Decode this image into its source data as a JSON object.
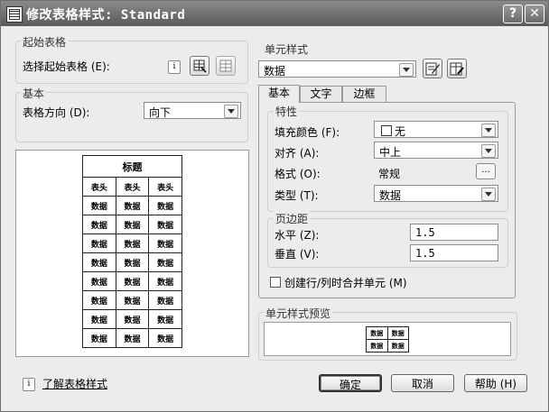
{
  "window": {
    "title": "修改表格样式: Standard",
    "help_glyph": "?",
    "close_glyph": "✕"
  },
  "starting_table": {
    "group_label": "起始表格",
    "select_label": "选择起始表格 (E):"
  },
  "general": {
    "group_label": "基本",
    "direction_label": "表格方向 (D):",
    "direction_value": "向下"
  },
  "preview_table": {
    "title": "标题",
    "headers": [
      "表头",
      "表头",
      "表头"
    ],
    "cell": "数据",
    "data_rows": 8
  },
  "cell_style": {
    "group_label": "单元样式",
    "value": "数据",
    "tabs": [
      "基本",
      "文字",
      "边框"
    ],
    "active_tab": "基本"
  },
  "properties": {
    "group_label": "特性",
    "fill_label": "填充颜色 (F):",
    "fill_value": "无",
    "align_label": "对齐 (A):",
    "align_value": "中上",
    "format_label": "格式 (O):",
    "format_value": "常规",
    "format_button": "...",
    "type_label": "类型 (T):",
    "type_value": "数据"
  },
  "margins": {
    "group_label": "页边距",
    "horizontal_label": "水平 (Z):",
    "horizontal_value": "1.5",
    "vertical_label": "垂直 (V):",
    "vertical_value": "1.5"
  },
  "merge": {
    "label": "创建行/列时合并单元 (M)",
    "checked": false
  },
  "cell_preview": {
    "group_label": "单元样式预览",
    "cell": "数据"
  },
  "footer": {
    "learn_link": "了解表格样式",
    "ok": "确定",
    "cancel": "取消",
    "help": "帮助 (H)"
  },
  "icons": {
    "info": "i",
    "app": "table-style-icon",
    "select_table": "select-table-icon",
    "delete_table": "delete-table-icon",
    "create_cell_style": "create-cell-style-icon",
    "manage_cell_style": "manage-cell-style-icon"
  }
}
